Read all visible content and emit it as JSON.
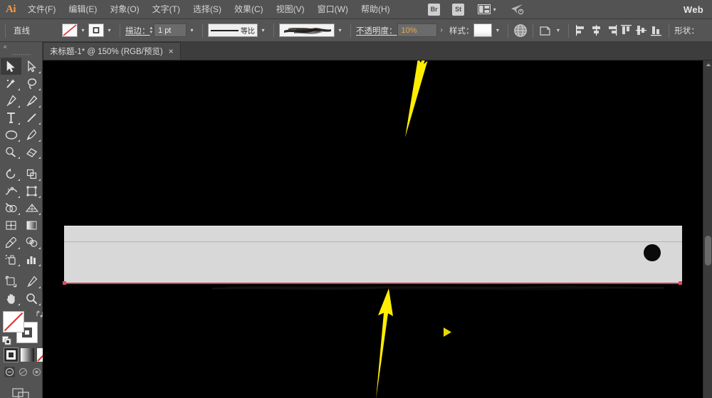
{
  "app": {
    "name": "Adobe Illustrator",
    "logo_text": "Ai",
    "workspace_label": "Web"
  },
  "menubar": {
    "items": [
      {
        "label": "文件(F)",
        "name": "menu-file"
      },
      {
        "label": "编辑(E)",
        "name": "menu-edit"
      },
      {
        "label": "对象(O)",
        "name": "menu-object"
      },
      {
        "label": "文字(T)",
        "name": "menu-type"
      },
      {
        "label": "选择(S)",
        "name": "menu-select"
      },
      {
        "label": "效果(C)",
        "name": "menu-effect"
      },
      {
        "label": "视图(V)",
        "name": "menu-view"
      },
      {
        "label": "窗口(W)",
        "name": "menu-window"
      },
      {
        "label": "帮助(H)",
        "name": "menu-help"
      }
    ],
    "bridge_label": "Br",
    "stock_label": "St",
    "arrange_icon": "arrange-documents-icon",
    "share_icon": "share-icon"
  },
  "controlbar": {
    "object_type": "直线",
    "fill_label": "fill-swatch-none",
    "stroke_swatch_label": "stroke-swatch",
    "stroke_label": "描边：",
    "stroke_weight": "1 pt",
    "stroke_profile": "等比",
    "brush_definition": "charcoal-brush",
    "opacity_label": "不透明度：",
    "opacity_value": "10%",
    "opacity_more": "›",
    "style_label": "样式：",
    "shape_label": "形状：",
    "recolor_icon": "recolor-artwork-icon",
    "transform_icon": "transform-icon",
    "align_icons": [
      "align-left-icon",
      "align-center-h-icon",
      "align-right-icon",
      "align-top-icon",
      "align-center-v-icon",
      "align-bottom-icon"
    ]
  },
  "tabbar": {
    "document_title": "未标题-1* @ 150% (RGB/预览)",
    "close_glyph": "×"
  },
  "toolbar": {
    "collapse_glyph": "«",
    "tools": [
      {
        "name": "selection-tool",
        "active": true
      },
      {
        "name": "direct-selection-tool",
        "active": false
      },
      {
        "name": "magic-wand-tool",
        "active": false
      },
      {
        "name": "lasso-tool",
        "active": false
      },
      {
        "name": "pen-tool",
        "active": false
      },
      {
        "name": "curvature-tool",
        "active": false
      },
      {
        "name": "type-tool",
        "active": false
      },
      {
        "name": "line-segment-tool",
        "active": false
      },
      {
        "name": "ellipse-tool",
        "active": false
      },
      {
        "name": "paintbrush-tool",
        "active": false
      },
      {
        "name": "shaper-tool",
        "active": false
      },
      {
        "name": "eraser-tool",
        "active": false
      },
      {
        "name": "rotate-tool",
        "active": false
      },
      {
        "name": "scale-tool",
        "active": false
      },
      {
        "name": "width-tool",
        "active": false
      },
      {
        "name": "free-transform-tool",
        "active": false
      },
      {
        "name": "shape-builder-tool",
        "active": false
      },
      {
        "name": "perspective-grid-tool",
        "active": false
      },
      {
        "name": "mesh-tool",
        "active": false
      },
      {
        "name": "gradient-tool",
        "active": false
      },
      {
        "name": "eyedropper-tool",
        "active": false
      },
      {
        "name": "blend-tool",
        "active": false
      },
      {
        "name": "symbol-sprayer-tool",
        "active": false
      },
      {
        "name": "column-graph-tool",
        "active": false
      },
      {
        "name": "artboard-tool",
        "active": false
      },
      {
        "name": "slice-tool",
        "active": false
      },
      {
        "name": "hand-tool",
        "active": false
      },
      {
        "name": "zoom-tool",
        "active": false
      }
    ],
    "fill_state": "none",
    "stroke_state": "black",
    "color_mode_buttons": [
      "color-button",
      "gradient-button",
      "none-button"
    ],
    "drawing_mode_buttons": [
      "draw-normal-button",
      "draw-behind-button",
      "draw-inside-button"
    ],
    "screen_mode": "change-screen-mode-button"
  },
  "canvas": {
    "background_color": "#000000",
    "artboard_fill": "#d8d8d8",
    "selection_color": "#c73a4e",
    "circle_color": "#0a0a0a",
    "annotation_color": "#ffee00",
    "annotations": [
      {
        "name": "arrow-pointing-to-opacity",
        "direction": "up-right"
      },
      {
        "name": "arrow-pointing-to-brush-stroke",
        "direction": "up"
      },
      {
        "name": "play-cursor-marker",
        "direction": "right"
      }
    ]
  },
  "scrollbar": {
    "vertical": "vertical-scrollbar"
  }
}
